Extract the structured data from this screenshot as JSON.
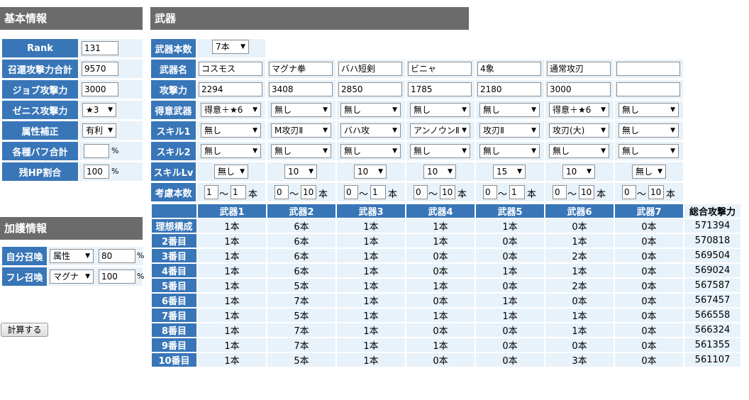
{
  "basic": {
    "title": "基本情報",
    "rows": [
      {
        "label": "Rank",
        "value": "131"
      },
      {
        "label": "召還攻撃力合計",
        "value": "9570"
      },
      {
        "label": "ジョブ攻撃力",
        "value": "3000"
      },
      {
        "label": "ゼニス攻撃力",
        "value": "★3"
      },
      {
        "label": "属性補正",
        "value": "有利"
      },
      {
        "label": "各種バフ合計",
        "value": ""
      },
      {
        "label": "残HP割合",
        "value": "100"
      }
    ],
    "percent": "%"
  },
  "blessing": {
    "title": "加護情報",
    "rows": [
      {
        "label": "自分召喚",
        "type": "属性",
        "value": "80"
      },
      {
        "label": "フレ召喚",
        "type": "マグナ",
        "value": "100"
      }
    ],
    "percent": "%"
  },
  "calc_button": "計算する",
  "weapons": {
    "title": "武器",
    "count_label": "武器本数",
    "count_value": "7本",
    "row_labels": {
      "name": "武器名",
      "attack": "攻撃力",
      "specialty": "得意武器",
      "skill1": "スキル1",
      "skill2": "スキル2",
      "skill_lv": "スキルLv",
      "range": "考慮本数"
    },
    "names": [
      "コスモス",
      "マグナ拳",
      "バハ短剣",
      "ビニャ",
      "4象",
      "通常攻刃",
      ""
    ],
    "attacks": [
      "2294",
      "3408",
      "2850",
      "1785",
      "2180",
      "3000",
      ""
    ],
    "specialty": [
      "得意＋★6",
      "無し",
      "無し",
      "無し",
      "無し",
      "得意＋★6",
      "無し"
    ],
    "skill1": [
      "無し",
      "M攻刃Ⅱ",
      "バハ攻",
      "アンノウンⅡ",
      "攻刃Ⅱ",
      "攻刃(大)",
      "無し"
    ],
    "skill2": [
      "無し",
      "無し",
      "無し",
      "無し",
      "無し",
      "無し",
      "無し"
    ],
    "skill_lv": [
      "無し",
      "10",
      "10",
      "10",
      "15",
      "10",
      "無し"
    ],
    "range_min": [
      "1",
      "0",
      "0",
      "0",
      "0",
      "0",
      "0"
    ],
    "range_max": [
      "1",
      "10",
      "1",
      "10",
      "1",
      "10",
      "10"
    ],
    "range_sep": "〜",
    "range_unit": "本"
  },
  "results": {
    "headers": [
      "武器1",
      "武器2",
      "武器3",
      "武器4",
      "武器5",
      "武器6",
      "武器7",
      "総合攻撃力"
    ],
    "rows": [
      {
        "label": "理想構成",
        "cells": [
          "1本",
          "6本",
          "1本",
          "1本",
          "1本",
          "0本",
          "0本"
        ],
        "total": "571394"
      },
      {
        "label": "2番目",
        "cells": [
          "1本",
          "6本",
          "1本",
          "1本",
          "0本",
          "1本",
          "0本"
        ],
        "total": "570818"
      },
      {
        "label": "3番目",
        "cells": [
          "1本",
          "6本",
          "1本",
          "0本",
          "0本",
          "2本",
          "0本"
        ],
        "total": "569504"
      },
      {
        "label": "4番目",
        "cells": [
          "1本",
          "6本",
          "1本",
          "0本",
          "1本",
          "1本",
          "0本"
        ],
        "total": "569024"
      },
      {
        "label": "5番目",
        "cells": [
          "1本",
          "5本",
          "1本",
          "1本",
          "0本",
          "2本",
          "0本"
        ],
        "total": "567587"
      },
      {
        "label": "6番目",
        "cells": [
          "1本",
          "7本",
          "1本",
          "0本",
          "1本",
          "0本",
          "0本"
        ],
        "total": "567457"
      },
      {
        "label": "7番目",
        "cells": [
          "1本",
          "5本",
          "1本",
          "1本",
          "1本",
          "1本",
          "0本"
        ],
        "total": "566558"
      },
      {
        "label": "8番目",
        "cells": [
          "1本",
          "7本",
          "1本",
          "0本",
          "0本",
          "1本",
          "0本"
        ],
        "total": "566324"
      },
      {
        "label": "9番目",
        "cells": [
          "1本",
          "7本",
          "1本",
          "1本",
          "0本",
          "0本",
          "0本"
        ],
        "total": "561355"
      },
      {
        "label": "10番目",
        "cells": [
          "1本",
          "5本",
          "1本",
          "0本",
          "0本",
          "3本",
          "0本"
        ],
        "total": "561107"
      }
    ]
  }
}
